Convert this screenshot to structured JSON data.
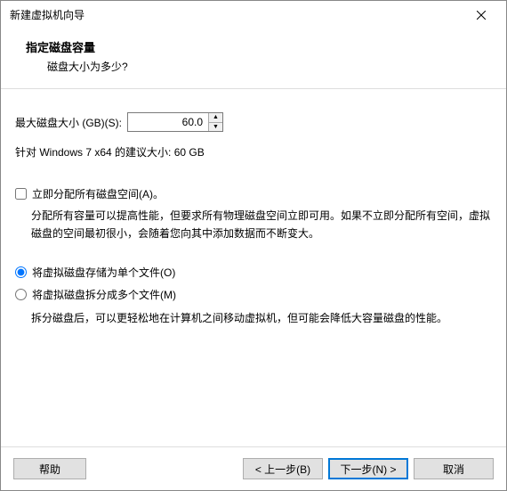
{
  "window": {
    "title": "新建虚拟机向导"
  },
  "header": {
    "heading": "指定磁盘容量",
    "subheading": "磁盘大小为多少?"
  },
  "size": {
    "label": "最大磁盘大小 (GB)(S):",
    "value": "60.0",
    "recommend": "针对 Windows 7 x64 的建议大小: 60 GB"
  },
  "allocate": {
    "label": "立即分配所有磁盘空间(A)。",
    "desc": "分配所有容量可以提高性能，但要求所有物理磁盘空间立即可用。如果不立即分配所有空间，虚拟磁盘的空间最初很小，会随着您向其中添加数据而不断变大。"
  },
  "storage": {
    "single": "将虚拟磁盘存储为单个文件(O)",
    "split": "将虚拟磁盘拆分成多个文件(M)",
    "split_desc": "拆分磁盘后，可以更轻松地在计算机之间移动虚拟机，但可能会降低大容量磁盘的性能。"
  },
  "buttons": {
    "help": "帮助",
    "back": "< 上一步(B)",
    "next": "下一步(N) >",
    "cancel": "取消"
  }
}
